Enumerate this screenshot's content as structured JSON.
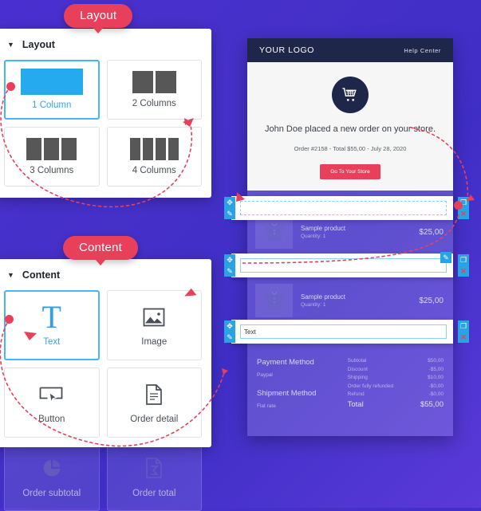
{
  "callouts": {
    "layout_pill": "Layout",
    "content_pill": "Content"
  },
  "layout_panel": {
    "title": "Layout",
    "caret": "▼",
    "tiles": [
      {
        "label": "1 Column",
        "icon": "one-column-icon",
        "selected": true
      },
      {
        "label": "2 Columns",
        "icon": "two-columns-icon",
        "selected": false
      },
      {
        "label": "3 Columns",
        "icon": "three-columns-icon",
        "selected": false
      },
      {
        "label": "4 Columns",
        "icon": "four-columns-icon",
        "selected": false
      }
    ]
  },
  "content_panel": {
    "title": "Content",
    "caret": "▼",
    "tiles": [
      {
        "label": "Text",
        "icon": "text-t-icon",
        "selected": true
      },
      {
        "label": "Image",
        "icon": "image-icon",
        "selected": false
      },
      {
        "label": "Button",
        "icon": "button-icon",
        "selected": false
      },
      {
        "label": "Order detail",
        "icon": "document-icon",
        "selected": false
      }
    ],
    "disabled_tiles": [
      {
        "label": "Order subtotal",
        "icon": "pie-chart-icon"
      },
      {
        "label": "Order total",
        "icon": "sigma-document-icon"
      }
    ]
  },
  "email": {
    "logo": "YOUR LOGO",
    "help_link": "Help Center",
    "hero_icon": "shopping-cart-icon",
    "headline": "John Doe placed a new order on your store.",
    "order_line": "Order #2158 - Total $55,00 - July 28, 2020",
    "cta_label": "Go To Your Store",
    "products": [
      {
        "name": "Sample product",
        "quantity": "Quantity: 1",
        "price": "$25,00"
      },
      {
        "name": "Sample product",
        "quantity": "Quantity: 1",
        "price": "$25,00"
      }
    ],
    "payment": {
      "payment_method_title": "Payment Method",
      "payment_method_value": "Paypal",
      "shipment_method_title": "Shipment Method",
      "shipment_method_value": "Flat rate"
    },
    "summary": [
      {
        "label": "Subtotal",
        "value": "$50,00"
      },
      {
        "label": "Discount",
        "value": "-$5,00"
      },
      {
        "label": "Shipping",
        "value": "$10,00"
      },
      {
        "label": "Order fully refunded",
        "value": "-$0,00"
      },
      {
        "label": "Refund",
        "value": "-$0,00"
      }
    ],
    "total": {
      "label": "Total",
      "value": "$55,00"
    }
  },
  "edit_rows": [
    {
      "value": "",
      "placeholder": "",
      "style": "dashed"
    },
    {
      "value": "",
      "placeholder": "",
      "style": "solid"
    },
    {
      "value": "Text",
      "placeholder": "",
      "style": "solid"
    }
  ],
  "handles": {
    "move": "✥",
    "edit": "✎",
    "duplicate": "❐",
    "delete": "✕"
  },
  "colors": {
    "background": "#4530c8",
    "accent_pink": "#e8405a",
    "accent_blue": "#29a3e3",
    "email_dark": "#1e2749"
  }
}
